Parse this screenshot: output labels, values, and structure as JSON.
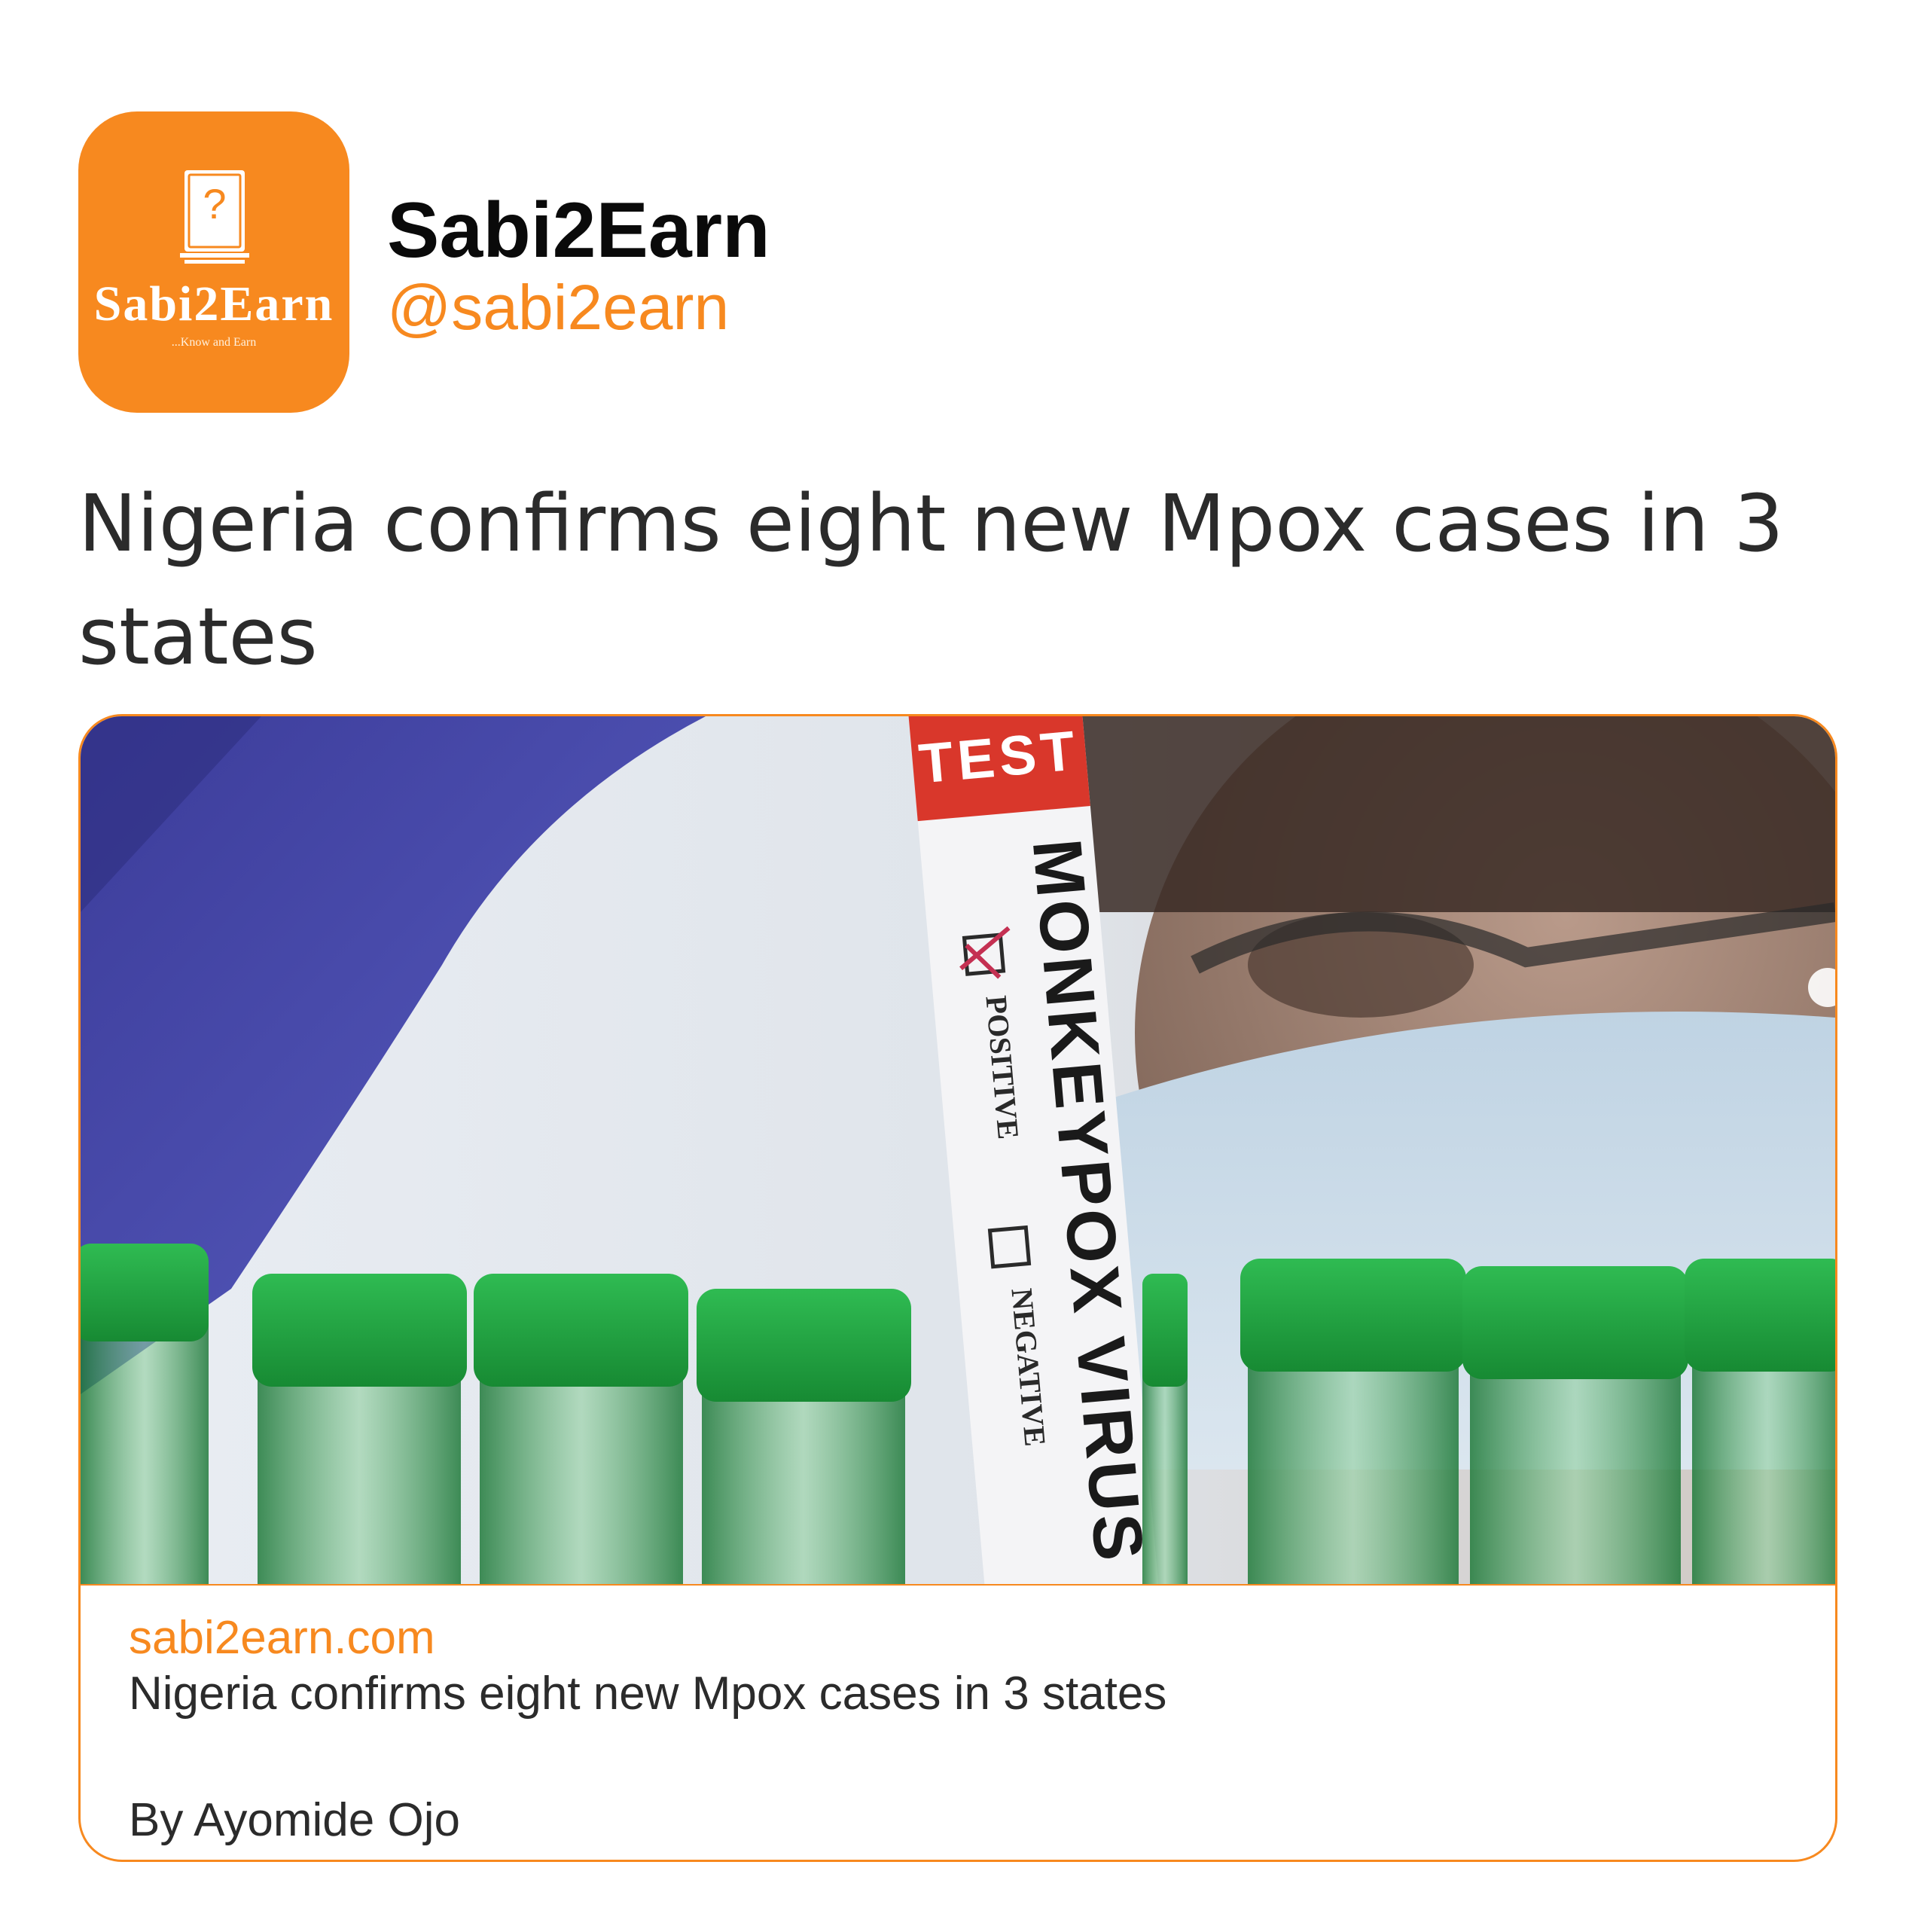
{
  "account": {
    "name": "Sabi2Earn",
    "handle": "@sabi2earn",
    "avatar": {
      "icon": "book-question-icon",
      "logo_text": "Sabi2Earn",
      "tagline": "...Know and Earn"
    }
  },
  "tweet": {
    "text": "Nigeria confirms eight new Mpox cases in 3 states"
  },
  "card": {
    "domain": "sabi2earn.com",
    "title": "Nigeria confirms eight new Mpox cases in 3 states",
    "byline": "By Ayomide Ojo",
    "image": {
      "tube_label_top": "TEST",
      "tube_label_main": "MONKEYPOX VIRUS",
      "tube_label_positive": "POSITIVE",
      "tube_label_negative": "NEGATIVE"
    }
  },
  "colors": {
    "accent": "#f7891f",
    "text": "#2b2b2b",
    "name": "#0a0a0a",
    "tube_red": "#d9372b",
    "cap_green": "#1f9e3e"
  }
}
